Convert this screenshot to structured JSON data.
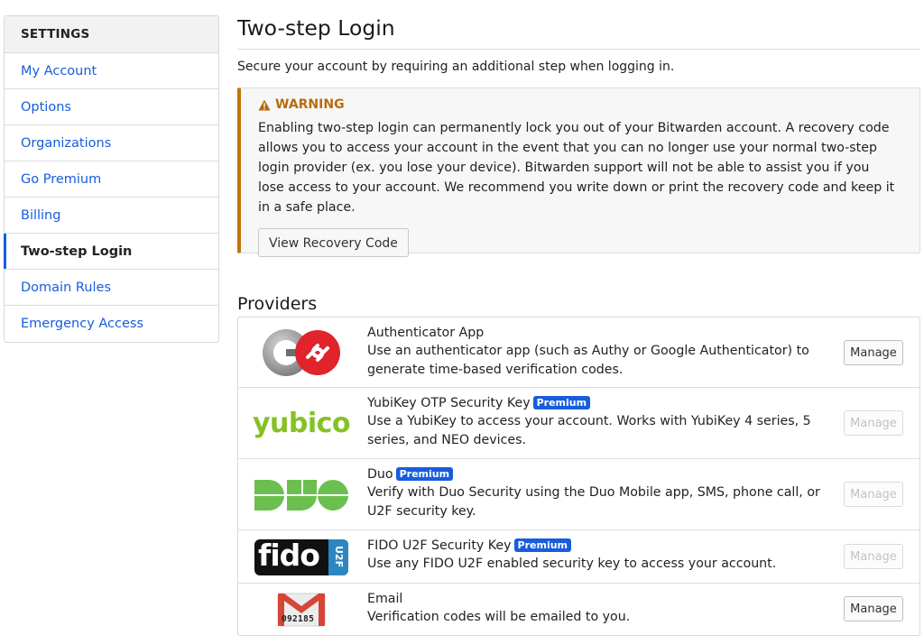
{
  "sidebar": {
    "header": "SETTINGS",
    "items": [
      {
        "label": "My Account"
      },
      {
        "label": "Options"
      },
      {
        "label": "Organizations"
      },
      {
        "label": "Go Premium"
      },
      {
        "label": "Billing"
      },
      {
        "label": "Two-step Login"
      },
      {
        "label": "Domain Rules"
      },
      {
        "label": "Emergency Access"
      }
    ],
    "active_index": 5
  },
  "page": {
    "title": "Two-step Login",
    "subtitle": "Secure your account by requiring an additional step when logging in."
  },
  "warning": {
    "title": "WARNING",
    "body": "Enabling two-step login can permanently lock you out of your Bitwarden account. A recovery code allows you to access your account in the event that you can no longer use your normal two-step login provider (ex. you lose your device). Bitwarden support will not be able to assist you if you lose access to your account. We recommend you write down or print the recovery code and keep it in a safe place.",
    "button_label": "View Recovery Code"
  },
  "providers": {
    "heading": "Providers",
    "premium_badge": "Premium",
    "manage_label": "Manage",
    "items": [
      {
        "name": "Authenticator App",
        "description": "Use an authenticator app (such as Authy or Google Authenticator) to generate time-based verification codes.",
        "premium": false,
        "manage_enabled": true,
        "logo": "authenticator-logo-icon"
      },
      {
        "name": "YubiKey OTP Security Key",
        "description": "Use a YubiKey to access your account. Works with YubiKey 4 series, 5 series, and NEO devices.",
        "premium": true,
        "manage_enabled": false,
        "logo": "yubico-logo-icon",
        "logo_text": "yubico"
      },
      {
        "name": "Duo",
        "description": "Verify with Duo Security using the Duo Mobile app, SMS, phone call, or U2F security key.",
        "premium": true,
        "manage_enabled": false,
        "logo": "duo-logo-icon"
      },
      {
        "name": "FIDO U2F Security Key",
        "description": "Use any FIDO U2F enabled security key to access your account.",
        "premium": true,
        "manage_enabled": false,
        "logo": "fido-logo-icon",
        "logo_text": "fido",
        "logo_subtext": "U2F"
      },
      {
        "name": "Email",
        "description": "Verification codes will be emailed to you.",
        "premium": false,
        "manage_enabled": true,
        "logo": "email-logo-icon",
        "logo_text": "092185"
      }
    ]
  },
  "colors": {
    "link": "#175ddc",
    "warning": "#b86b0c",
    "yubico_green": "#84c225",
    "duo_green": "#6bbf4e",
    "gmail_red": "#d44638"
  }
}
